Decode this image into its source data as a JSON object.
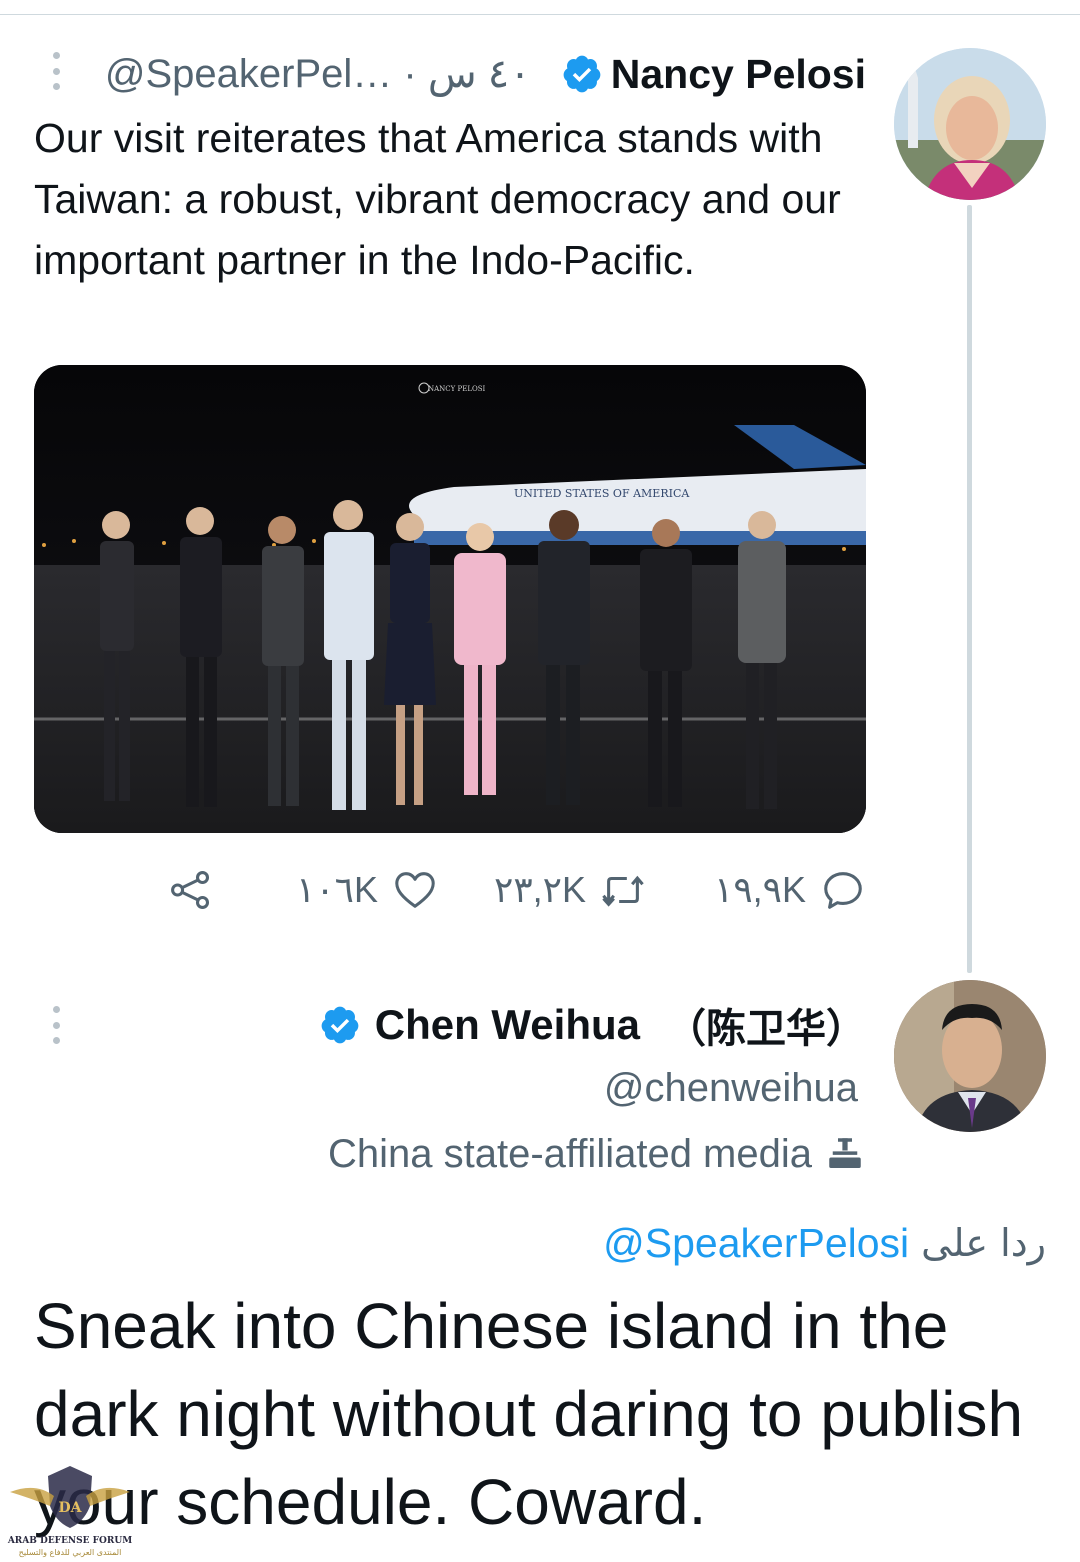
{
  "tweet": {
    "author": {
      "name": "Nancy Pelosi",
      "meta": "@SpeakerPel… · ٤٠ س",
      "verified": true
    },
    "text": "Our visit reiterates that America stands with Taiwan: a robust, vibrant democracy and our important partner in the Indo-Pacific.",
    "media": {
      "watermark_text": "NANCY PELOSI",
      "plane_text": "UNITED STATES OF AMERICA"
    },
    "actions": {
      "reply_count": "١٩,٩K",
      "retweet_count": "٢٣,٢K",
      "like_count": "١٠٦K"
    }
  },
  "reply": {
    "author": {
      "name": "Chen Weihua",
      "name_cn": "（陈卫华）",
      "handle": "@chenweihua",
      "label": "China state-affiliated media",
      "verified": true
    },
    "replying_to_prefix": "ردا على",
    "replying_to_handle": "@SpeakerPelosi",
    "text": "Sneak into Chinese island in the dark night without daring to publish your schedule. Coward."
  },
  "watermark": {
    "logo": "DA",
    "name": "ARAB DEFENSE FORUM",
    "arabic": "المنتدى العربي للدفاع والتسليح"
  },
  "colors": {
    "accent": "#1d9bf0",
    "secondary_text": "#536471",
    "primary_text": "#0f1419",
    "divider": "#cfd9de"
  },
  "icons": [
    "more-vert-icon",
    "verified-badge-icon",
    "share-icon",
    "like-icon",
    "retweet-icon",
    "reply-icon",
    "state-media-icon"
  ]
}
